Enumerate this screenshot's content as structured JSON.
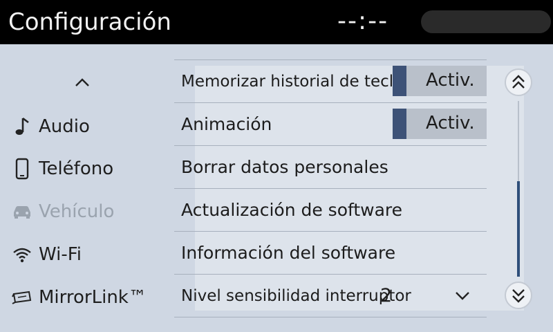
{
  "header": {
    "title": "Configuración",
    "clock": "--:--"
  },
  "sidebar": {
    "scroll_up_icon": "chevron-up-icon",
    "items": [
      {
        "label": "Audio",
        "icon": "music-note-icon",
        "enabled": true
      },
      {
        "label": "Teléfono",
        "icon": "phone-icon",
        "enabled": true
      },
      {
        "label": "Vehículo",
        "icon": "car-icon",
        "enabled": false
      },
      {
        "label": "Wi-Fi",
        "icon": "wifi-icon",
        "enabled": true
      },
      {
        "label": "MirrorLink™",
        "icon": "mirrorlink-icon",
        "enabled": true
      }
    ]
  },
  "settings": {
    "rows": [
      {
        "label": "Memorizar historial de teclado",
        "toggle": "Activ."
      },
      {
        "label": "Animación",
        "toggle": "Activ."
      },
      {
        "label": "Borrar datos personales"
      },
      {
        "label": "Actualización de software"
      },
      {
        "label": "Información del software"
      },
      {
        "label": "Nivel sensibilidad interruptor",
        "value": "2"
      }
    ],
    "scroll_position": 0.6
  },
  "colors": {
    "header_bg": "#000000",
    "page_bg": "#cfd7e3",
    "toggle_indicator": "#3d5277",
    "scroll_thumb": "#2f4f7a",
    "disabled_text": "#9aa3ae"
  }
}
